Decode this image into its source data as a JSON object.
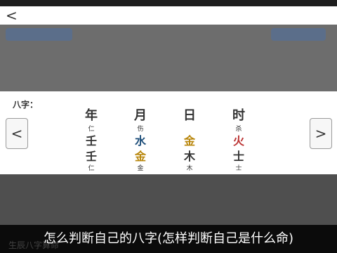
{
  "nav": {
    "back_glyph": "<",
    "prev_glyph": "<",
    "next_glyph": ">"
  },
  "panel": {
    "label": "八字：",
    "columns": [
      {
        "header": "年",
        "top_tag": "仁",
        "stem": "壬",
        "branch": "壬",
        "bottom_tag": "仁"
      },
      {
        "header": "月",
        "top_tag": "伤",
        "stem": "水",
        "branch": "金",
        "bottom_tag": "金"
      },
      {
        "header": "日",
        "top_tag": "",
        "stem": "金",
        "branch": "木",
        "bottom_tag": "木"
      },
      {
        "header": "时",
        "top_tag": "杀",
        "stem": "火",
        "branch": "士",
        "bottom_tag": "士"
      }
    ]
  },
  "caption": {
    "text": "怎么判断自己的八字(怎样判断自己是什么命)",
    "sub": "生辰八字算命"
  }
}
